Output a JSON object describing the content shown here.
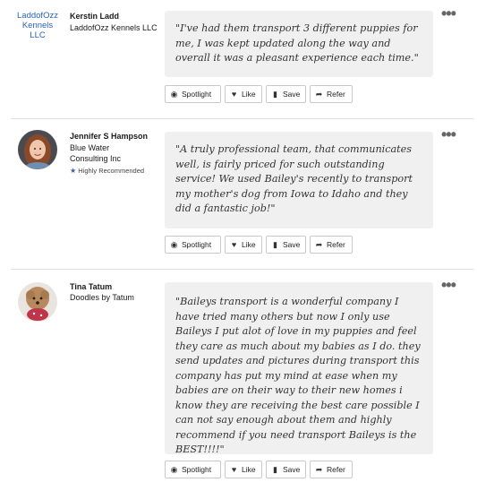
{
  "reviews": [
    {
      "name": "Kerstin Ladd",
      "company": "LaddofOzz Kennels LLC",
      "logo_alt": "LaddofOzz Kennels LLC",
      "badge": "",
      "quote": "\"I've had them transport 3 different puppies for me, I was kept updated along the way and overall it was a pleasant experience each time.\""
    },
    {
      "name": "Jennifer S Hampson",
      "company": "Blue Water Consulting Inc",
      "badge": "Highly Recommended",
      "quote": "\"A truly professional team, that communicates well, is fairly priced for such outstanding service! We used Bailey's recently to transport my mother's dog from Iowa to Idaho and they did a fantastic job!\""
    },
    {
      "name": "Tina Tatum",
      "company": "Doodles by Tatum",
      "badge": "",
      "quote": "\"Baileys transport is a wonderful company I have tried many others but now I only use Baileys I put alot of love in my puppies and feel they care as much about my babies as I do. they send updates and pictures during transport this company has put my mind at ease when my babies are on their way to their new homes i know they are receiving the best care possible I can not say enough about them and highly recommend if you need transport Baileys is the BEST!!!!\""
    }
  ],
  "actions": {
    "spotlight": "Spotlight",
    "like": "Like",
    "save": "Save",
    "refer": "Refer"
  },
  "more_label": "•••",
  "colors": {
    "quote_bg": "#f0f0f0",
    "badge_star": "#3b5b9a",
    "logo_text": "#2a62b8"
  }
}
